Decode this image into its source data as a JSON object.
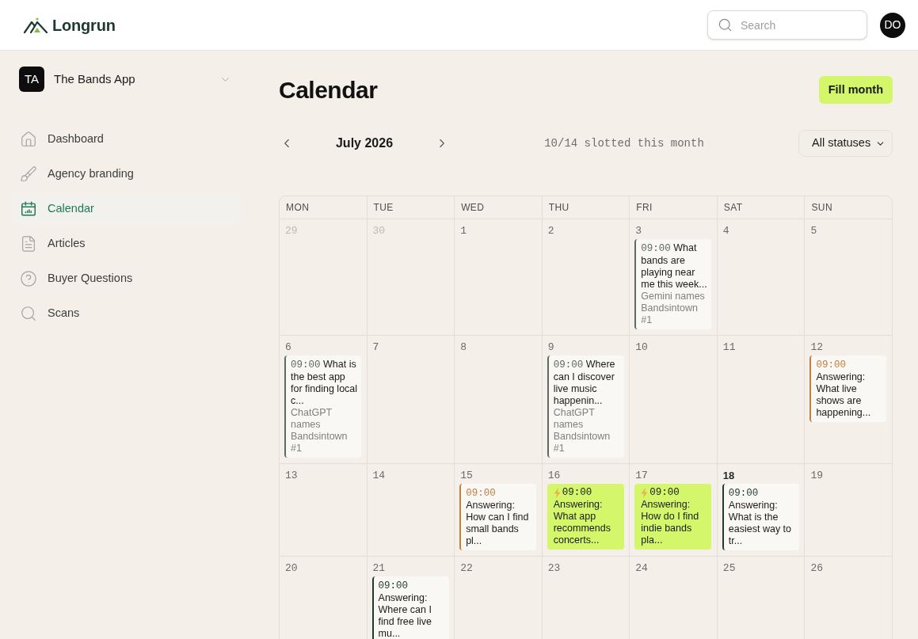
{
  "header": {
    "brand": "Longrun",
    "search": {
      "placeholder": "Search"
    },
    "avatar": "DO"
  },
  "sidebar": {
    "workspace": {
      "initials": "TA",
      "name": "The Bands App"
    },
    "items": [
      {
        "label": "Dashboard",
        "selected": false
      },
      {
        "label": "Agency branding",
        "selected": false
      },
      {
        "label": "Calendar",
        "selected": true
      },
      {
        "label": "Articles",
        "selected": false
      },
      {
        "label": "Buyer Questions",
        "selected": false
      },
      {
        "label": "Scans",
        "selected": false
      }
    ]
  },
  "page": {
    "title": "Calendar",
    "action": "Fill month"
  },
  "toolbar": {
    "month": "July 2026",
    "summary": "10/14 slotted this month",
    "filter": {
      "value": "All statuses"
    }
  },
  "calendar": {
    "weekdays": [
      "MON",
      "TUE",
      "WED",
      "THU",
      "FRI",
      "SAT",
      "SUN"
    ],
    "weeks": [
      {
        "days": [
          {
            "day": "29",
            "outside": true,
            "today": false
          },
          {
            "day": "30",
            "outside": true,
            "today": false
          },
          {
            "day": "1",
            "outside": false,
            "today": false
          },
          {
            "day": "2",
            "outside": false,
            "today": false
          },
          {
            "day": "3",
            "outside": false,
            "today": false,
            "events": [
              {
                "kind": "card",
                "color": "#5e6a63",
                "time": "09:00",
                "title": "What bands are playing near me this week...",
                "note": "Gemini names Bandsintown #1"
              }
            ]
          },
          {
            "day": "4",
            "outside": false,
            "today": false
          },
          {
            "day": "5",
            "outside": false,
            "today": false
          }
        ]
      },
      {
        "days": [
          {
            "day": "6",
            "outside": false,
            "today": false,
            "events": [
              {
                "kind": "card",
                "color": "#5e6a63",
                "time": "09:00",
                "title": "What is the best app for finding local c...",
                "note": "ChatGPT names Bandsintown #1"
              }
            ]
          },
          {
            "day": "7",
            "outside": false,
            "today": false
          },
          {
            "day": "8",
            "outside": false,
            "today": false
          },
          {
            "day": "9",
            "outside": false,
            "today": false,
            "events": [
              {
                "kind": "card",
                "color": "#5e6a63",
                "time": "09:00",
                "title": "Where can I discover live music happenin...",
                "note": "ChatGPT names Bandsintown #1"
              }
            ]
          },
          {
            "day": "10",
            "outside": false,
            "today": false
          },
          {
            "day": "11",
            "outside": false,
            "today": false
          },
          {
            "day": "12",
            "outside": false,
            "today": false,
            "events": [
              {
                "kind": "card",
                "color": "#c0803f",
                "time": "09:00",
                "title": "Answering: What live shows are happening..."
              }
            ]
          }
        ]
      },
      {
        "days": [
          {
            "day": "13",
            "outside": false,
            "today": false
          },
          {
            "day": "14",
            "outside": false,
            "today": false
          },
          {
            "day": "15",
            "outside": false,
            "today": false,
            "events": [
              {
                "kind": "card",
                "color": "#c0803f",
                "time": "09:00",
                "title": "Answering: How can I find small bands pl..."
              }
            ]
          },
          {
            "day": "16",
            "outside": false,
            "today": false,
            "events": [
              {
                "kind": "highlight",
                "time": "09:00",
                "title": "Answering: What app recommends concerts..."
              }
            ]
          },
          {
            "day": "17",
            "outside": false,
            "today": false,
            "events": [
              {
                "kind": "highlight",
                "time": "09:00",
                "title": "Answering: How do I find indie bands pla..."
              }
            ]
          },
          {
            "day": "18",
            "outside": false,
            "today": true,
            "events": [
              {
                "kind": "card",
                "color": "#1f3a2f",
                "time": "09:00",
                "title": "Answering: What is the easiest way to tr..."
              }
            ]
          },
          {
            "day": "19",
            "outside": false,
            "today": false
          }
        ]
      },
      {
        "days": [
          {
            "day": "20",
            "outside": false,
            "today": false
          },
          {
            "day": "21",
            "outside": false,
            "today": false,
            "events": [
              {
                "kind": "card",
                "color": "#1f3a2f",
                "time": "09:00",
                "title": "Answering: Where can I find free live mu..."
              }
            ]
          },
          {
            "day": "22",
            "outside": false,
            "today": false
          },
          {
            "day": "23",
            "outside": false,
            "today": false
          },
          {
            "day": "24",
            "outside": false,
            "today": false
          },
          {
            "day": "25",
            "outside": false,
            "today": false
          },
          {
            "day": "26",
            "outside": false,
            "today": false
          }
        ]
      }
    ]
  }
}
